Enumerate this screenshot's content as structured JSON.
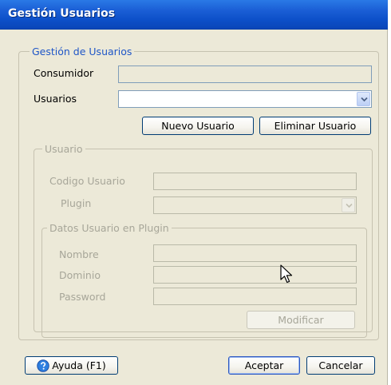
{
  "window": {
    "title": "Gestión Usuarios"
  },
  "gestion_group": {
    "legend": "Gestión de Usuarios",
    "consumidor_label": "Consumidor",
    "consumidor_value": "",
    "usuarios_label": "Usuarios",
    "usuarios_value": "",
    "nuevo_button": "Nuevo Usuario",
    "eliminar_button": "Eliminar Usuario"
  },
  "usuario_group": {
    "legend": "Usuario",
    "codigo_label": "Codigo Usuario",
    "codigo_value": "",
    "plugin_label": "Plugin",
    "plugin_value": ""
  },
  "datos_group": {
    "legend": "Datos Usuario en Plugin",
    "nombre_label": "Nombre",
    "nombre_value": "",
    "dominio_label": "Dominio",
    "dominio_value": "",
    "password_label": "Password",
    "password_value": "",
    "modificar_button": "Modificar"
  },
  "footer": {
    "help_button": "Ayuda (F1)",
    "accept_button": "Aceptar",
    "cancel_button": "Cancelar"
  },
  "icons": {
    "help": "help-question-icon",
    "combo": "chevron-down-icon",
    "pointer": "mouse-cursor-icon"
  },
  "colors": {
    "title_bar": "#0c4fc8",
    "dialog_bg": "#ece9d8",
    "legend_accent": "#1f56c7",
    "disabled_text": "#a7a699"
  }
}
